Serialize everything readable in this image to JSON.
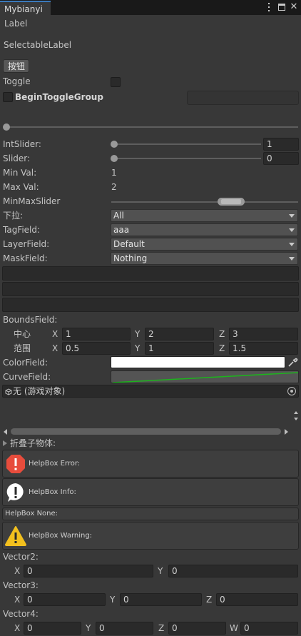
{
  "tab": {
    "title": "Mybianyi"
  },
  "header_icons": {
    "menu": "kebab-icon",
    "maximize": "maximize-icon",
    "close": "close-icon"
  },
  "label": "Label",
  "selectable_label": "SelectableLabel",
  "button_label": "按钮",
  "toggle_label": "Toggle",
  "toggle_group_label": "BeginToggleGroup",
  "int_slider": {
    "label": "IntSlider:",
    "value": "1"
  },
  "slider": {
    "label": "Slider:",
    "value": "0"
  },
  "min_val": {
    "label": "Min Val:",
    "value": "1"
  },
  "max_val": {
    "label": "Max Val:",
    "value": "2"
  },
  "minmax_label": "MinMaxSlider",
  "dropdowns": {
    "popup": {
      "label": "下拉:",
      "value": "All"
    },
    "tag": {
      "label": "TagField:",
      "value": "aaa"
    },
    "layer": {
      "label": "LayerField:",
      "value": "Default"
    },
    "mask": {
      "label": "MaskField:",
      "value": "Nothing"
    }
  },
  "bounds": {
    "label": "BoundsField:",
    "center_label": "中心",
    "extent_label": "范围",
    "center": {
      "x": "1",
      "y": "2",
      "z": "3"
    },
    "extent": {
      "x": "0.5",
      "y": "1",
      "z": "1.5"
    }
  },
  "color_field_label": "ColorField:",
  "color_value": "#ffffff",
  "curve_field_label": "CurveField:",
  "object_field_value": "无 (游戏对象)",
  "foldout_label": "折叠子物体:",
  "helpbox": {
    "error": "HelpBox Error:",
    "info": "HelpBox Info:",
    "none": "HelpBox None:",
    "warning": "HelpBox Warning:"
  },
  "axis": {
    "x": "X",
    "y": "Y",
    "z": "Z",
    "w": "W"
  },
  "vector2": {
    "label": "Vector2:",
    "x": "0",
    "y": "0"
  },
  "vector3": {
    "label": "Vector3:",
    "x": "0",
    "y": "0",
    "z": "0"
  },
  "vector4": {
    "label": "Vector4:",
    "x": "0",
    "y": "0",
    "z": "0",
    "w": "0"
  },
  "colors": {
    "error": "#e74c3c",
    "warning": "#f2c01e",
    "curve": "#1db31d"
  }
}
